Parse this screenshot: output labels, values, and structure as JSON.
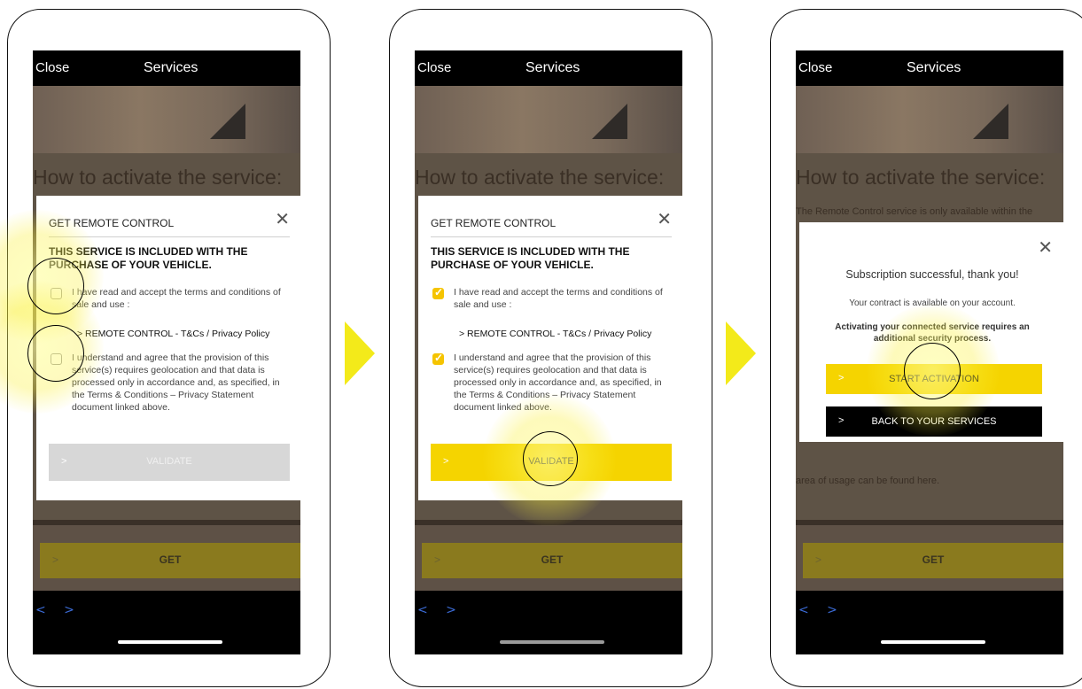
{
  "common": {
    "close_label": "Close",
    "title": "Services",
    "heading": "How to activate the service:",
    "get_label": "GET",
    "nav_arrows": "< >",
    "chevron": ">"
  },
  "step1": {
    "modal_title": "GET REMOTE CONTROL",
    "lead": "THIS SERVICE IS INCLUDED WITH THE PURCHASE OF YOUR VEHICLE.",
    "check1_text": "I have read and accept the terms and conditions of sale and use :",
    "check1_checked": false,
    "link_text": ">  REMOTE CONTROL - T&Cs / Privacy Policy",
    "check2_text": "I understand and agree that the provision of this service(s) requires geolocation and that data is processed only in accordance and, as specified, in the Terms & Conditions – Privacy Statement document linked above.",
    "check2_checked": false,
    "validate_label": "VALIDATE"
  },
  "step2": {
    "modal_title": "GET REMOTE CONTROL",
    "lead": "THIS SERVICE IS INCLUDED WITH THE PURCHASE OF YOUR VEHICLE.",
    "check1_text": "I have read and accept the terms and conditions of sale and use :",
    "check1_checked": true,
    "link_text": ">  REMOTE CONTROL - T&Cs / Privacy Policy",
    "check2_text": "I understand and agree that the provision of this service(s) requires geolocation and that data is processed only in accordance and, as specified, in the Terms & Conditions – Privacy Statement document linked above.",
    "check2_checked": true,
    "validate_label": "VALIDATE"
  },
  "step3": {
    "body_text_top": "The Remote Control service is only available within the",
    "body_text_bottom": "area of usage can be found here.",
    "success_text": "Subscription successful, thank you!",
    "contract_text": "Your contract is available on your account.",
    "security_text": "Activating your connected service requires an additional security process.",
    "start_label": "START ACTIVATION",
    "back_label": "BACK TO YOUR SERVICES"
  },
  "colors": {
    "accent_yellow": "#f5d400",
    "arrow_yellow": "#f3ea1a",
    "nav_blue": "#3b6bd6"
  }
}
